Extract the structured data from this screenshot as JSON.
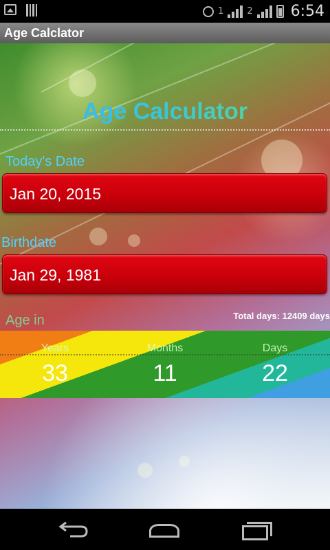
{
  "status_bar": {
    "time": "6:54",
    "sim1": "1",
    "sim2": "2",
    "icons": [
      "image-icon",
      "barcode-icon",
      "alarm-icon",
      "signal-icon",
      "data-icon",
      "battery-icon"
    ]
  },
  "app_bar": {
    "title": "Age Calclator"
  },
  "main": {
    "heading": "Age Calculator",
    "today_label": "Today's Date",
    "today_value": "Jan 20, 2015",
    "birth_label": "Birthdate",
    "birth_value": "Jan 29, 1981",
    "age_label": "Age in",
    "total_days": "Total days: 12409 days",
    "age": [
      {
        "label": "Years",
        "value": "33"
      },
      {
        "label": "Months",
        "value": "11"
      },
      {
        "label": "Days",
        "value": "22"
      }
    ]
  },
  "nav_bar": {
    "icons": [
      "back-icon",
      "home-icon",
      "recent-apps-icon"
    ]
  },
  "colors": {
    "accent_text": "#4fd2ff",
    "date_box": "#c6000a",
    "title_gradient": [
      "#3ab0ff",
      "#5fe07a"
    ]
  }
}
